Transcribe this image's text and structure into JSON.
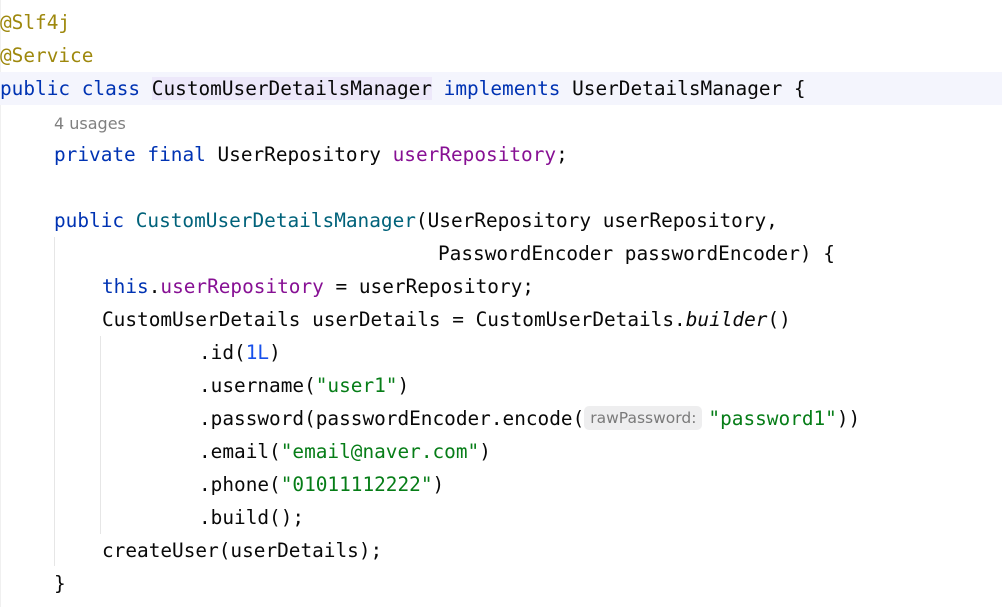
{
  "editor": {
    "annotation_slf4j": "@Slf4j",
    "annotation_service": "@Service",
    "class_decl": {
      "kw_public": "public",
      "kw_class": "class",
      "class_name": "CustomUserDetailsManager",
      "kw_implements": "implements",
      "interface_name": "UserDetailsManager",
      "brace": " {"
    },
    "usages_hint": "4 usages",
    "field_decl": {
      "kw_private": "private",
      "kw_final": "final",
      "type": "UserRepository",
      "name": "userRepository",
      "semicolon": ";"
    },
    "constructor": {
      "kw_public": "public",
      "name": "CustomUserDetailsManager",
      "params_line1": "(UserRepository userRepository,",
      "params_line2": "PasswordEncoder passwordEncoder) {"
    },
    "assign": {
      "kw_this": "this",
      "dot": ".",
      "field": "userRepository",
      "rest": " = userRepository;"
    },
    "builder_line": {
      "prefix": "CustomUserDetails userDetails = CustomUserDetails.",
      "method": "builder",
      "suffix": "()"
    },
    "chain": {
      "id_prefix": ".id(",
      "id_value": "1L",
      "id_suffix": ")",
      "username_prefix": ".username(",
      "username_value": "\"user1\"",
      "username_suffix": ")",
      "password_prefix": ".password(passwordEncoder.encode(",
      "password_hint": "rawPassword:",
      "password_value": "\"password1\"",
      "password_suffix": "))",
      "email_prefix": ".email(",
      "email_value": "\"email@naver.com\"",
      "email_suffix": ")",
      "phone_prefix": ".phone(",
      "phone_value": "\"01011112222\"",
      "phone_suffix": ")",
      "build": ".build();"
    },
    "create_user": "createUser(userDetails);",
    "closing_brace": "}"
  }
}
